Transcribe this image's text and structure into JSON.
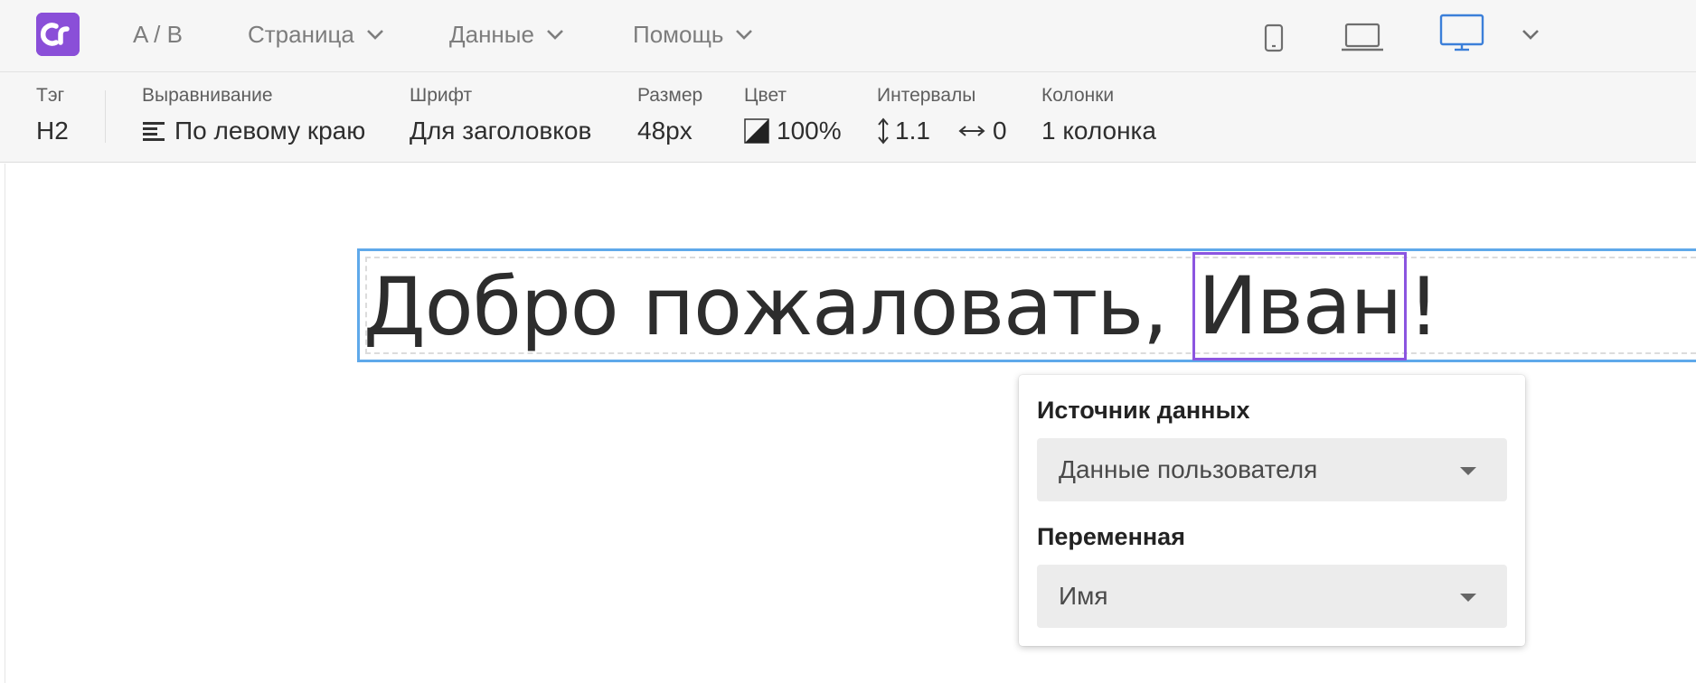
{
  "app": {
    "logo_text": "Cr",
    "brand_color": "#8a4fd8"
  },
  "menu": {
    "ab_label": "A / B",
    "page_label": "Страница",
    "data_label": "Данные",
    "help_label": "Помощь"
  },
  "devices": {
    "items": [
      "phone-icon",
      "laptop-icon",
      "desktop-icon"
    ],
    "selected": "desktop-icon",
    "accent_color": "#3b7fd9"
  },
  "toolbar": {
    "tag": {
      "label": "Тэг",
      "value": "H2"
    },
    "align": {
      "label": "Выравнивание",
      "value": "По левому краю"
    },
    "font": {
      "label": "Шрифт",
      "value": "Для заголовков"
    },
    "size": {
      "label": "Размер",
      "value": "48px"
    },
    "color": {
      "label": "Цвет",
      "value": "100%"
    },
    "spacing": {
      "label": "Интервалы",
      "line_height": "1.1",
      "letter_spacing": "0"
    },
    "columns": {
      "label": "Колонки",
      "value": "1 колонка"
    }
  },
  "canvas": {
    "heading_before": "Добро пожаловать, ",
    "heading_variable": "Иван",
    "heading_after": "!",
    "selection_color": "#5fa9ea",
    "variable_color": "#8b55e0"
  },
  "popover": {
    "source_label": "Источник данных",
    "source_value": "Данные пользователя",
    "variable_label": "Переменная",
    "variable_value": "Имя"
  }
}
